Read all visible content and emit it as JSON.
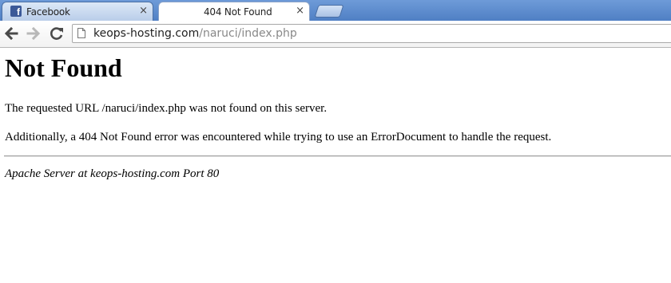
{
  "tabs": [
    {
      "title": "Facebook",
      "icon": "facebook-icon",
      "close": "×",
      "active": false
    },
    {
      "title": "404 Not Found",
      "close": "×",
      "active": true
    }
  ],
  "toolbar": {
    "url_host": "keops-hosting.com",
    "url_path": "/naruci/index.php"
  },
  "page": {
    "heading": "Not Found",
    "paragraph1": "The requested URL /naruci/index.php was not found on this server.",
    "paragraph2": "Additionally, a 404 Not Found error was encountered while trying to use an ErrorDocument to handle the request.",
    "address": "Apache Server at keops-hosting.com Port 80"
  },
  "colors": {
    "tabstrip": "#4f7fc4",
    "facebook_brand": "#3b5998"
  }
}
